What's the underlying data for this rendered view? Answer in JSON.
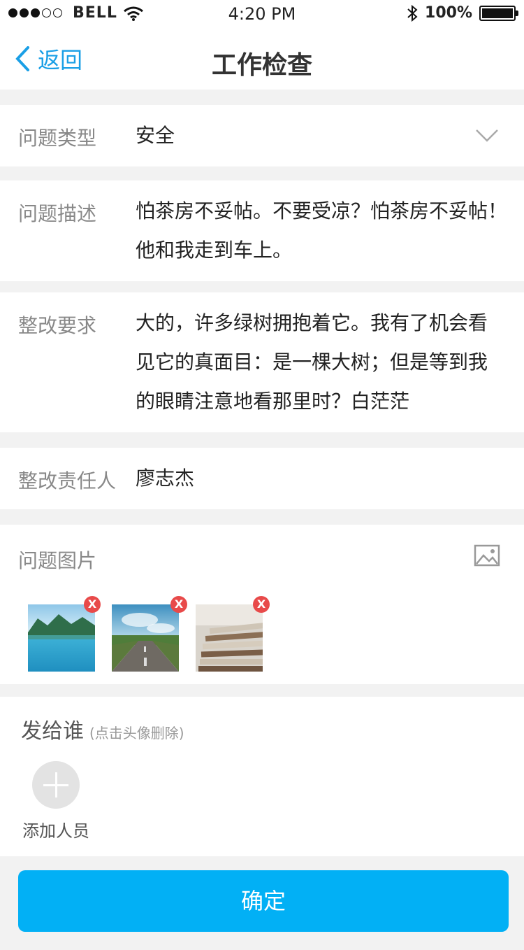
{
  "status_bar": {
    "carrier": "BELL",
    "time": "4:20 PM",
    "battery": "100%"
  },
  "nav": {
    "back_label": "返回",
    "title": "工作检查"
  },
  "form": {
    "problem_type": {
      "label": "问题类型",
      "value": "安全"
    },
    "problem_desc": {
      "label": "问题描述",
      "lines": [
        "怕茶房不妥帖。不要受凉？怕茶房不妥帖！",
        "他和我走到车上。"
      ]
    },
    "rectify_req": {
      "label": "整改要求",
      "lines": [
        "大的，许多绿树拥抱着它。我有了机会看",
        "见它的真面目：是一棵大树；但是等到我",
        "的眼睛注意地看那里时？白茫茫"
      ]
    },
    "responsible": {
      "label": "整改责任人",
      "value": "廖志杰"
    },
    "images": {
      "label": "问题图片",
      "delete_glyph": "X",
      "items": [
        "lake",
        "road",
        "papers"
      ]
    },
    "send_to": {
      "title": "发给谁",
      "hint": "(点击头像删除)",
      "add_label": "添加人员"
    }
  },
  "confirm_label": "确定"
}
